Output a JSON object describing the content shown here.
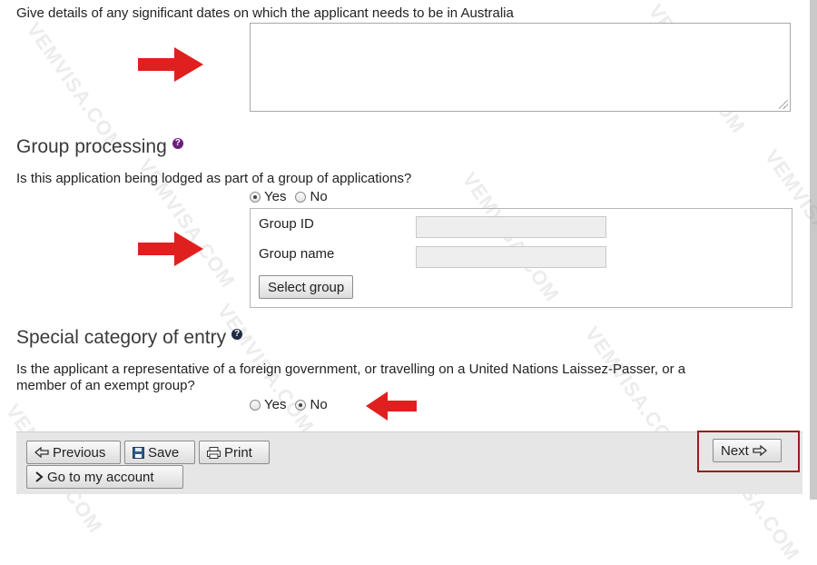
{
  "dates": {
    "question": "Give details of any significant dates on which the applicant needs to be in Australia",
    "value": ""
  },
  "group_processing": {
    "heading": "Group processing",
    "question": "Is this application being lodged as part of a group of applications?",
    "options": [
      "Yes",
      "No"
    ],
    "selected": "Yes",
    "group_id_label": "Group ID",
    "group_id_value": "",
    "group_name_label": "Group name",
    "group_name_value": "",
    "select_group_label": "Select group"
  },
  "special_category": {
    "heading": "Special category of entry",
    "question_line1": "Is the applicant a representative of a foreign government, or travelling on a United Nations Laissez-Passer, or a",
    "question_line2": "member of an exempt group?",
    "options": [
      "Yes",
      "No"
    ],
    "selected": "No"
  },
  "footer": {
    "previous_label": "Previous",
    "save_label": "Save",
    "print_label": "Print",
    "account_label": "Go to my account",
    "next_label": "Next"
  },
  "watermark_text": "VEMVISA.COM",
  "colors": {
    "help_icon_purple": "#6b1f7a",
    "help_icon_dark": "#1f2a44",
    "arrow_red": "#e0201e",
    "highlight_border": "#9b1c1c"
  }
}
